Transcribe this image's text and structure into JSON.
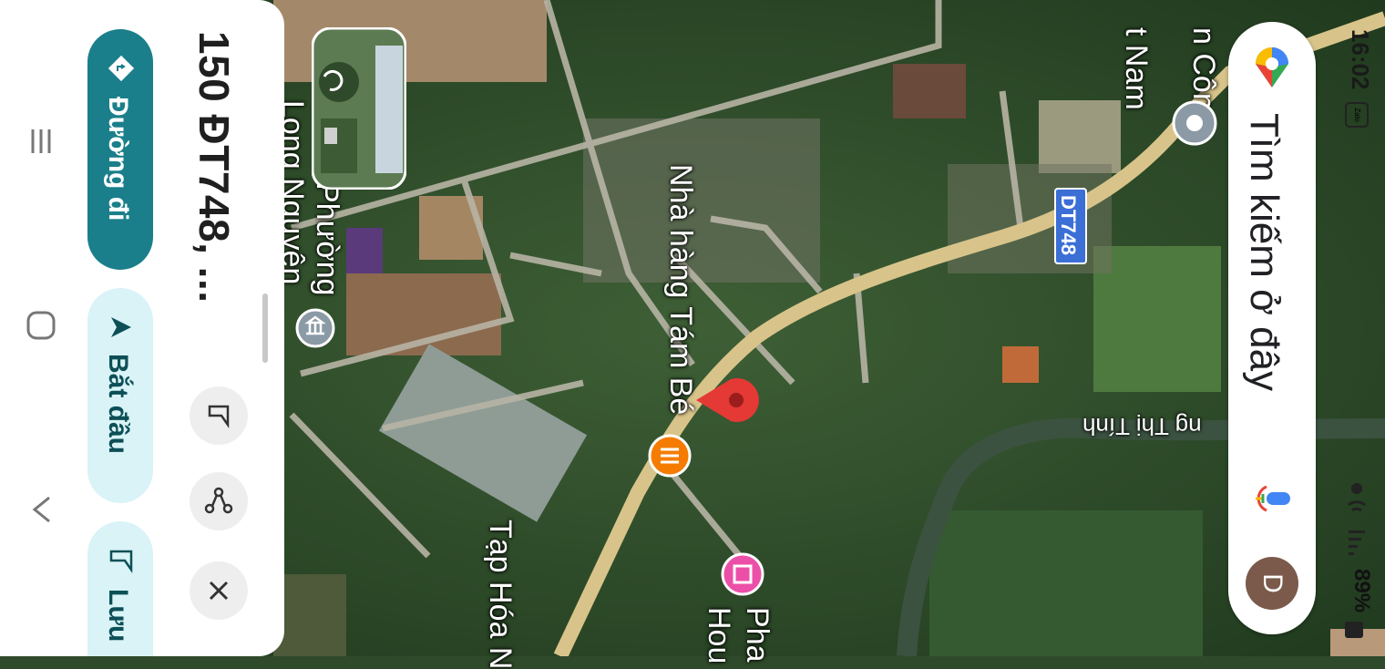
{
  "status_bar": {
    "time": "16:02",
    "battery": "89%",
    "app_badge": "Zalo"
  },
  "search": {
    "placeholder": "Tìm kiếm ở đây",
    "avatar_initial": "D"
  },
  "place": {
    "title": "150 ĐT748, ...",
    "actions": {
      "directions": "Đường đi",
      "start": "Bắt đầu",
      "save": "Lưu"
    }
  },
  "map": {
    "road_shield": "DT748",
    "labels": {
      "restaurant": "Nhà hàng Tám Bé",
      "ward": "Phường",
      "ward_name": "Long Nguyên",
      "grocery": "Tạp Hóa N",
      "pharmacy_1": "Pha",
      "pharmacy_2": "Hou",
      "street": "ng Thị Tính",
      "top_1": "n Công",
      "top_2": "t Nam"
    }
  },
  "colors": {
    "accent_teal": "#1a7f8a",
    "light_teal": "#d9f3f7",
    "pin_red": "#e53935",
    "restaurant_orange": "#f57c00",
    "road_yellow": "#d8c48a",
    "shield_blue": "#3b6fd6"
  },
  "icons": {
    "menu": "menu-icon",
    "home": "home-icon",
    "back": "chevron-up-icon",
    "save": "bookmark-icon",
    "share": "share-icon",
    "close": "close-icon",
    "mic": "mic-icon",
    "maps_logo": "maps-logo-icon"
  }
}
